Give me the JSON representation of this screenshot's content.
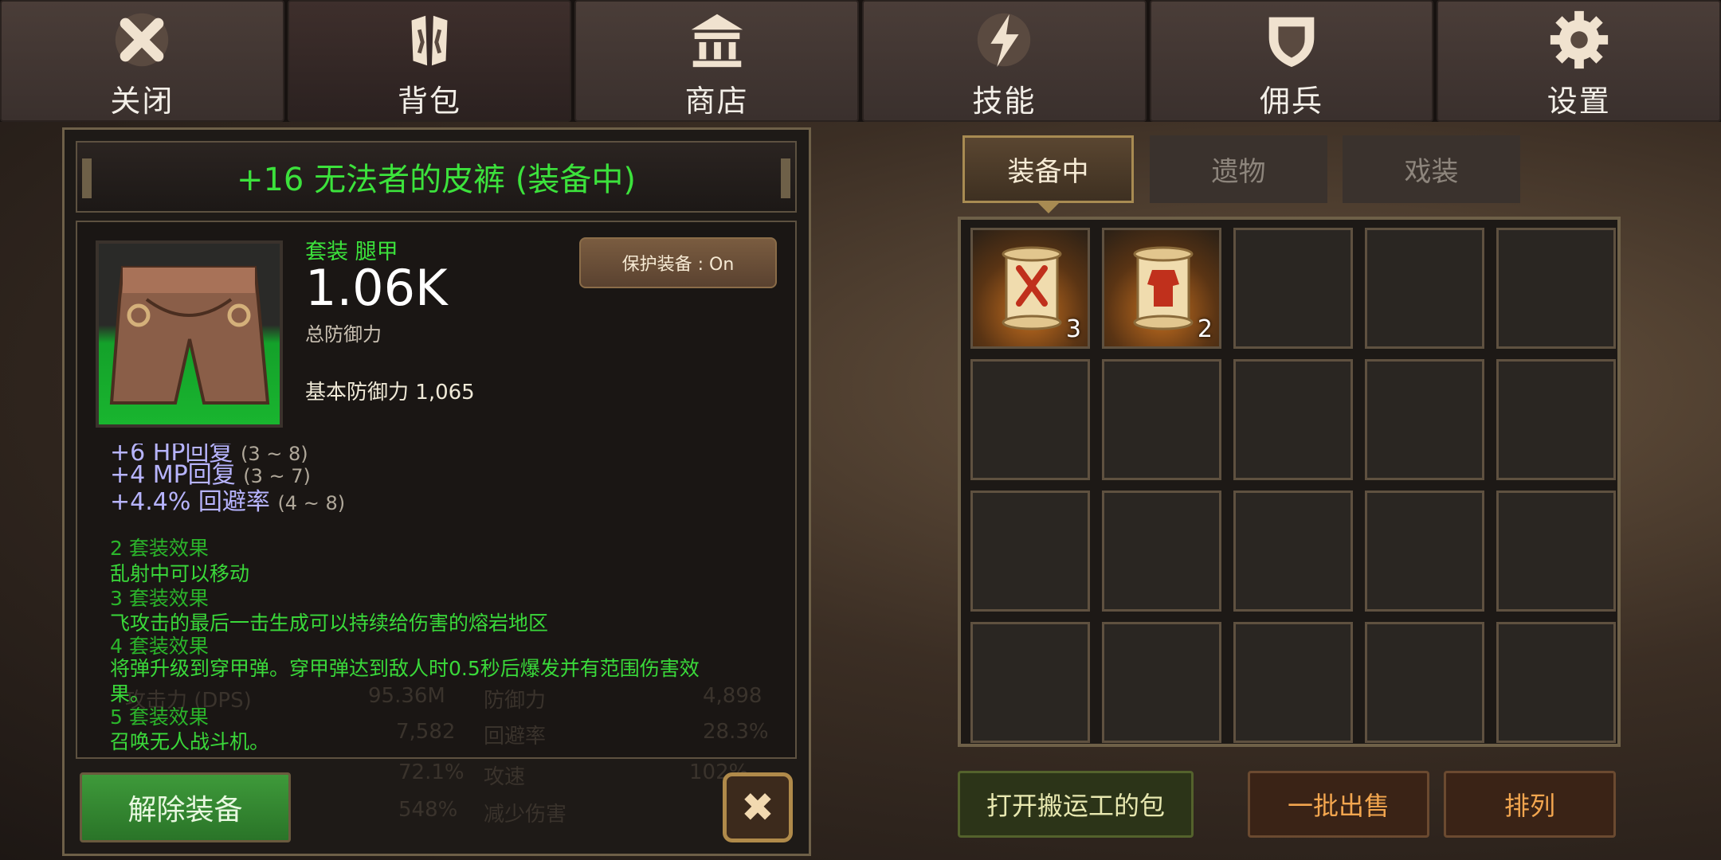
{
  "nav": {
    "tabs": [
      {
        "label": "关闭",
        "icon": "close-icon"
      },
      {
        "label": "背包",
        "icon": "backpack-icon"
      },
      {
        "label": "商店",
        "icon": "shop-icon"
      },
      {
        "label": "技能",
        "icon": "lightning-icon"
      },
      {
        "label": "佣兵",
        "icon": "shield-icon"
      },
      {
        "label": "设置",
        "icon": "gear-icon"
      }
    ],
    "active": "背包"
  },
  "item": {
    "title": "+16 无法者的皮裤 (装备中)",
    "category": "套装 腿甲",
    "total_defense": "1.06K",
    "total_defense_label": "总防御力",
    "base_defense_label": "基本防御力",
    "base_defense": "1,065",
    "protect_label": "保护装备 : On",
    "stats": [
      {
        "text": "+6 HP回复",
        "range": "(3 ~ 8)"
      },
      {
        "text": "+4 MP回复",
        "range": "(3 ~ 7)"
      },
      {
        "text": "+4.4% 回避率",
        "range": "(4 ~ 8)"
      }
    ],
    "set_effects": [
      {
        "header": "2 套装效果",
        "desc": "乱射中可以移动"
      },
      {
        "header": "3 套装效果",
        "desc": "飞攻击的最后一击生成可以持续给伤害的熔岩地区"
      },
      {
        "header": "4 套装效果",
        "desc": "将弹升级到穿甲弹。穿甲弹达到敌人时0.5秒后爆发并有范围伤害效",
        "desc2": "果。"
      },
      {
        "header": "5 套装效果",
        "desc": "召唤无人战斗机。"
      }
    ],
    "unequip_label": "解除装备"
  },
  "background_stats": {
    "dps_label": "攻击力 (DPS)",
    "dps_value": "95.36M",
    "defense_label": "防御力",
    "defense_value": "4,898",
    "hp_value": "7,582",
    "evasion_label": "回避率",
    "evasion_value": "28.3%",
    "crit_value": "72.1%",
    "speed_label": "攻速",
    "speed_value": "102%",
    "dmg_value": "548%",
    "dmg_label": "减少伤害"
  },
  "inventory": {
    "tabs": [
      {
        "label": "装备中"
      },
      {
        "label": "遗物"
      },
      {
        "label": "戏装"
      }
    ],
    "active_tab": "装备中",
    "items": [
      {
        "name": "scroll-red-sword",
        "count": "3"
      },
      {
        "name": "scroll-red-armor",
        "count": "2"
      }
    ],
    "buttons": {
      "carrier": "打开搬运工的包",
      "sell": "一批出售",
      "sort": "排列"
    }
  }
}
